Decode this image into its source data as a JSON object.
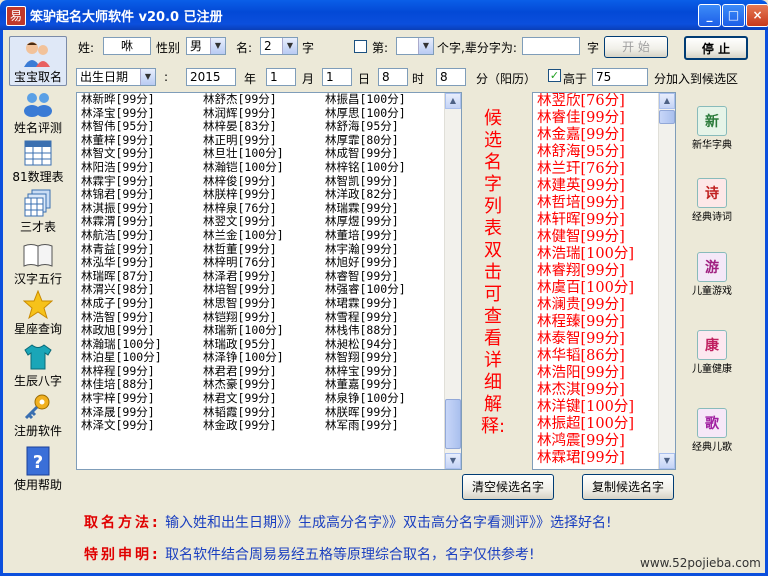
{
  "window": {
    "title": "笨驴起名大师软件 v20.0  已注册",
    "minimize": "_",
    "maximize": "□",
    "close": "×"
  },
  "sidebar": {
    "items": [
      {
        "label": "宝宝取名",
        "icon": "baby-icon"
      },
      {
        "label": "姓名评测",
        "icon": "people-icon"
      },
      {
        "label": "81数理表",
        "icon": "table-icon"
      },
      {
        "label": "三才表",
        "icon": "stack-icon"
      },
      {
        "label": "汉字五行",
        "icon": "book-icon"
      },
      {
        "label": "星座查询",
        "icon": "star-icon"
      },
      {
        "label": "生辰八字",
        "icon": "shirt-icon"
      },
      {
        "label": "注册软件",
        "icon": "key-icon"
      },
      {
        "label": "使用帮助",
        "icon": "help-icon"
      }
    ]
  },
  "form": {
    "surname_label": "姓:",
    "surname_value": "咻",
    "gender_label": "性别",
    "gender_value": "男",
    "name_label": "名:",
    "name_count": "2",
    "name_unit": "字",
    "nth_label": "第:",
    "nth_value": "",
    "generation_label": "个字,辈分字为:",
    "generation_value": "",
    "generation_unit": "字",
    "start_button": "开  始",
    "stop_button": "停  止",
    "date_type": "出生日期",
    "colon": ":",
    "year": "2015",
    "year_unit": "年",
    "month": "1",
    "month_unit": "月",
    "day": "1",
    "day_unit": "日",
    "hour": "8",
    "hour_unit": "时",
    "minute": "8",
    "minute_unit": "分（阳历）",
    "higher_label": "高于",
    "higher_checked": "✓",
    "threshold": "75",
    "threshold_suffix": "分加入到候选区"
  },
  "results": [
    "林新晔[99分]",
    "林泽宝[99分]",
    "林智伟[95分]",
    "林董梓[99分]",
    "林智文[99分]",
    "林阳浩[99分]",
    "林霖宇[99分]",
    "林锦君[99分]",
    "林淇振[99分]",
    "林霖渭[99分]",
    "林航浩[99分]",
    "林青益[99分]",
    "林泓华[99分]",
    "林瑞晖[87分]",
    "林渭兴[98分]",
    "林成子[99分]",
    "林浩智[99分]",
    "林政旭[99分]",
    "林瀚瑞[100分]",
    "林泊星[100分]",
    "林梓程[99分]",
    "林佳培[88分]",
    "林宇梓[99分]",
    "林泽晟[99分]",
    "林泽文[99分]",
    "林舒杰[99分]",
    "林润辉[99分]",
    "林梓晏[83分]",
    "林正明[99分]",
    "林旦壮[100分]",
    "林瀚铠[100分]",
    "林梓俊[99分]",
    "林朕梓[99分]",
    "林梓泉[76分]",
    "林翌文[99分]",
    "林兰金[100分]",
    "林哲董[99分]",
    "林梓明[76分]",
    "林泽君[99分]",
    "林培智[99分]",
    "林思智[99分]",
    "林铠翔[99分]",
    "林瑞新[100分]",
    "林瑞政[95分]",
    "林泽铮[100分]",
    "林君君[99分]",
    "林杰豪[99分]",
    "林君文[99分]",
    "林韬霞[99分]",
    "林金政[99分]",
    "林振昌[100分]",
    "林厚思[100分]",
    "林舒海[95分]",
    "林厚霏[80分]",
    "林成智[99分]",
    "林梓铭[100分]",
    "林智凯[99分]",
    "林洋政[82分]",
    "林瑞霖[99分]",
    "林厚煜[99分]",
    "林董培[99分]",
    "林宇瀚[99分]",
    "林旭好[99分]",
    "林睿智[99分]",
    "林强睿[100分]",
    "林珺霖[99分]",
    "林雪程[99分]",
    "林栈伟[88分]",
    "林昶松[94分]",
    "林智翔[99分]",
    "林梓宝[99分]",
    "林董嘉[99分]",
    "林泉铮[100分]",
    "林朕晖[99分]",
    "林军雨[99分]"
  ],
  "candidates_title": "候选名字列表双击可查看详细解释:",
  "candidates": [
    "林翌欣[76分]",
    "林睿佳[99分]",
    "林金嘉[99分]",
    "林舒海[95分]",
    "林兰玕[76分]",
    "林建英[99分]",
    "林哲培[99分]",
    "林轩晖[99分]",
    "林健智[99分]",
    "林浩瑞[100分]",
    "林睿翔[99分]",
    "林虞百[100分]",
    "林澜贵[99分]",
    "林程臻[99分]",
    "林泰智[99分]",
    "林华韬[86分]",
    "林浩阳[99分]",
    "林杰淇[99分]",
    "林洋键[100分]",
    "林振超[100分]",
    "林鸿震[99分]",
    "林霖珺[99分]"
  ],
  "buttons": {
    "clear": "清空候选名字",
    "copy": "复制候选名字"
  },
  "right_panel": [
    {
      "label": "新华字典",
      "glyph": "新",
      "color": "#2a7a3a"
    },
    {
      "label": "经典诗词",
      "glyph": "诗",
      "color": "#c02020"
    },
    {
      "label": "儿童游戏",
      "glyph": "游",
      "color": "#a02080"
    },
    {
      "label": "儿童健康",
      "glyph": "康",
      "color": "#c02060"
    },
    {
      "label": "经典儿歌",
      "glyph": "歌",
      "color": "#a020a0"
    }
  ],
  "footer": {
    "method_label": "取名方法:",
    "method_text": "输入姓和出生日期》》生成高分名字》》双击高分名字看测评》》选择好名!",
    "notice_label": "特别申明:",
    "notice_text": "取名软件结合周易易经五格等原理综合取名，名字仅供参考!",
    "watermark": "www.52pojieba.com"
  }
}
